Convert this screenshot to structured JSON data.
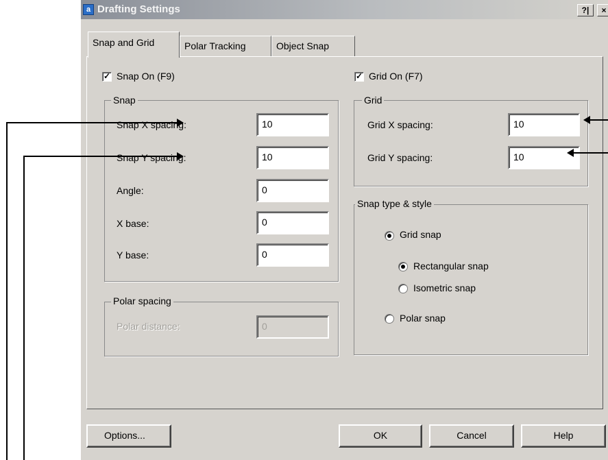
{
  "window": {
    "title": "Drafting Settings",
    "help_glyph": "?|",
    "close_glyph": "×",
    "app_icon_glyph": "a",
    "icon": "app-icon"
  },
  "tabs": [
    {
      "label": "Snap and Grid",
      "active": true
    },
    {
      "label": "Polar Tracking",
      "active": false
    },
    {
      "label": "Object Snap",
      "active": false
    }
  ],
  "snap_on": {
    "label": "Snap On (F9)",
    "checked": true
  },
  "grid_on": {
    "label": "Grid On (F7)",
    "checked": true
  },
  "check_glyph": "✓",
  "snap_group": {
    "title": "Snap",
    "x_spacing": {
      "label": "Snap X spacing:",
      "value": "10"
    },
    "y_spacing": {
      "label": "Snap Y spacing:",
      "value": "10"
    },
    "angle": {
      "label": "Angle:",
      "value": "0"
    },
    "x_base": {
      "label": "X base:",
      "value": "0"
    },
    "y_base": {
      "label": "Y base:",
      "value": "0"
    }
  },
  "polar_spacing_group": {
    "title": "Polar spacing",
    "polar_distance": {
      "label": "Polar distance:",
      "value": "0",
      "enabled": false
    }
  },
  "grid_group": {
    "title": "Grid",
    "x_spacing": {
      "label": "Grid X spacing:",
      "value": "10"
    },
    "y_spacing": {
      "label": "Grid Y spacing:",
      "value": "10"
    }
  },
  "snap_type_group": {
    "title": "Snap type & style",
    "grid_snap": {
      "label": "Grid snap",
      "selected": true
    },
    "rectangular_snap": {
      "label": "Rectangular snap",
      "selected": true
    },
    "isometric_snap": {
      "label": "Isometric snap",
      "selected": false
    },
    "polar_snap": {
      "label": "Polar snap",
      "selected": false
    }
  },
  "buttons": {
    "options": "Options...",
    "ok": "OK",
    "cancel": "Cancel",
    "help": "Help"
  },
  "colors": {
    "dialog_face": "#d6d3ce",
    "title_bar": "#8a8f98",
    "disabled_text": "#a2a09b"
  }
}
